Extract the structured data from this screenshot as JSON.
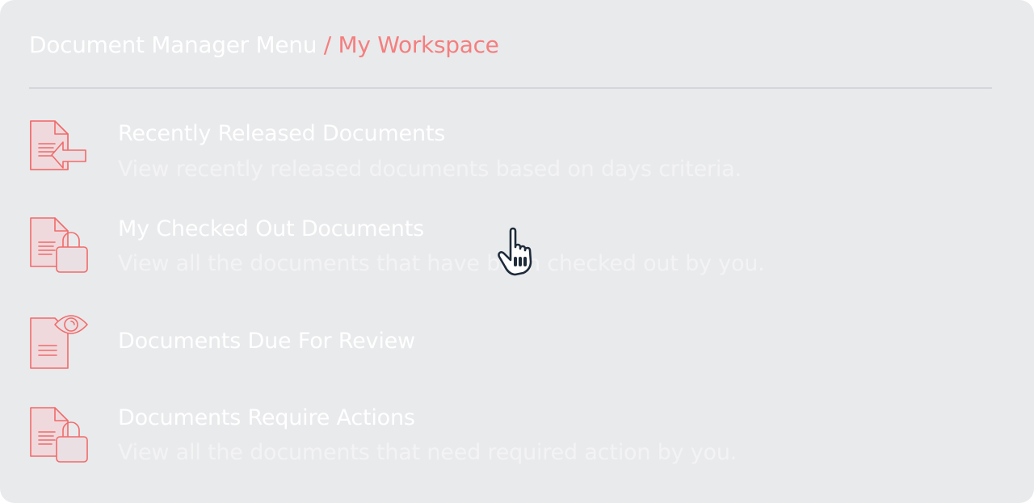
{
  "breadcrumb": {
    "root": "Document Manager Menu",
    "separator": " / ",
    "current": "My Workspace"
  },
  "colors": {
    "accent": "#f47f7f",
    "panel_bg": "#e9eaec",
    "divider": "#d3d6dc",
    "text": "#ffffff"
  },
  "menu": {
    "items": [
      {
        "icon": "document-released-arrow-icon",
        "title": "Recently Released Documents",
        "description": "View recently released documents based on days criteria."
      },
      {
        "icon": "document-lock-icon",
        "title": "My Checked Out Documents",
        "description": "View all the documents that have been checked out by you."
      },
      {
        "icon": "document-eye-icon",
        "title": "Documents Due For Review"
      },
      {
        "icon": "document-lock-icon",
        "title": "Documents Require Actions",
        "description": "View all the documents that need required action by you."
      }
    ]
  },
  "cursor": {
    "icon": "hand-pointer-icon"
  }
}
